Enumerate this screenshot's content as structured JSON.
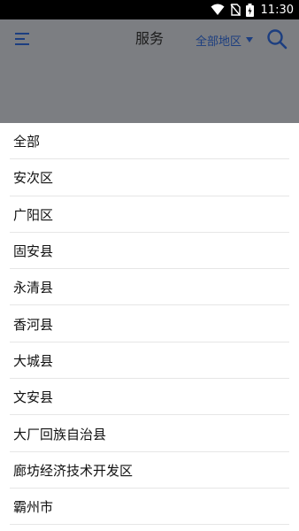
{
  "status_bar": {
    "time": "11:30"
  },
  "header": {
    "title": "服务",
    "region_selector": "全部地区"
  },
  "region_options": [
    "全部",
    "安次区",
    "广阳区",
    "固安县",
    "永清县",
    "香河县",
    "大城县",
    "文安县",
    "大厂回族自治县",
    "廊坊经济技术开发区",
    "霸州市"
  ],
  "colors": {
    "accent": "#1c3e80",
    "dim_overlay": "#7c7e82",
    "status_bar": "#000000"
  }
}
